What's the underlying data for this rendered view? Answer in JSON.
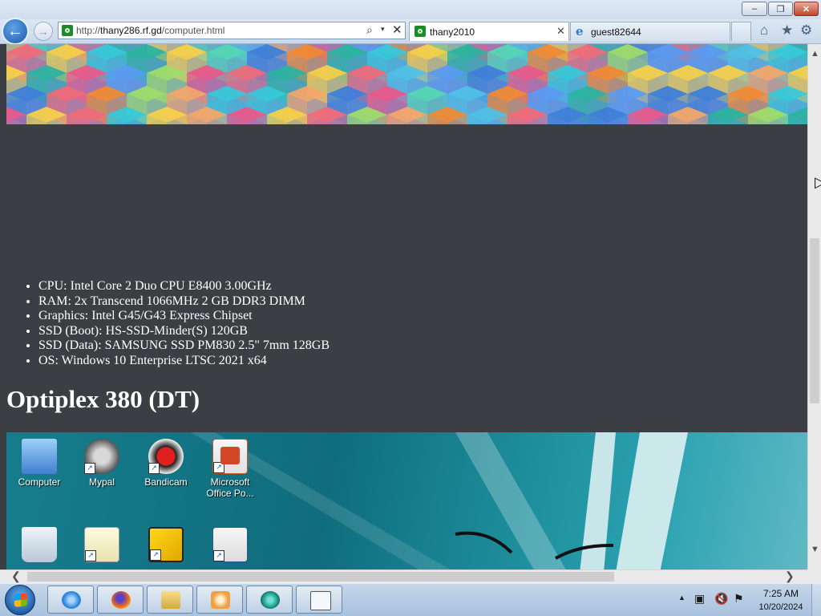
{
  "window": {
    "minimize": "–",
    "maximize": "❐",
    "close": "✕"
  },
  "browser": {
    "address": {
      "protocol": "http://",
      "domain": "thany286.rf.gd",
      "path": "/computer.html"
    },
    "tabs": [
      {
        "label": "thany2010",
        "active": true,
        "icon": "green-site-icon"
      },
      {
        "label": "guest82644",
        "active": false,
        "icon": "ie-icon"
      }
    ],
    "icons": {
      "back": "←",
      "forward": "→",
      "search": "⌕",
      "dropdown": "▾",
      "stop": "✕",
      "tab_close": "✕",
      "home": "⌂",
      "favorites": "★",
      "tools": "⚙"
    }
  },
  "page": {
    "specs": [
      "CPU: Intel Core 2 Duo CPU E8400 3.00GHz",
      "RAM: 2x Transcend 1066MHz 2 GB DDR3 DIMM",
      "Graphics: Intel G45/G43 Express Chipset",
      "SSD (Boot): HS-SSD-Minder(S) 120GB",
      "SSD (Data): SAMSUNG SSD PM830 2.5\" 7mm 128GB",
      "OS: Windows 10 Enterprise LTSC 2021 x64"
    ],
    "heading": "Optiplex 380 (DT)",
    "desktop_icons": [
      {
        "label": "Computer",
        "color": "#4a8ad8"
      },
      {
        "label": "Mypal",
        "color": "#6b6b6b"
      },
      {
        "label": "Bandicam",
        "color": "#c81818"
      },
      {
        "label": "Microsoft Office Po...",
        "color": "#d0451b"
      }
    ]
  },
  "scrollbars": {
    "up": "▲",
    "down": "▼",
    "left": "❮",
    "right": "❯"
  },
  "taskbar": {
    "apps": [
      {
        "name": "internet-explorer",
        "color": "#2f86d8"
      },
      {
        "name": "firefox",
        "color": "#e8681c"
      },
      {
        "name": "file-explorer",
        "color": "#e8c15a"
      },
      {
        "name": "media-player",
        "color": "#f0a040"
      },
      {
        "name": "streaming-app",
        "color": "#1f9c8c"
      },
      {
        "name": "notepad-window",
        "color": "#e8eef5"
      }
    ],
    "tray_up": "▲",
    "time": "7:25 AM",
    "date": "10/20/2024"
  }
}
